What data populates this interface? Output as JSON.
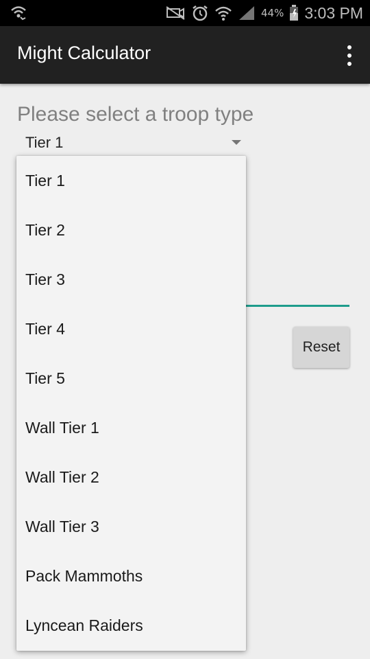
{
  "status_bar": {
    "battery_percent": "44%",
    "time": "3:03 PM",
    "icons": [
      "wifi-call-icon",
      "mute-icon",
      "alarm-icon",
      "wifi-icon",
      "signal-icon",
      "battery-icon"
    ]
  },
  "app_bar": {
    "title": "Might Calculator",
    "menu_icon": "overflow-menu-icon"
  },
  "form": {
    "prompt": "Please select a troop type",
    "selected_troop": "Tier 1",
    "reset_label": "Reset"
  },
  "dropdown": {
    "items": [
      {
        "label": "Tier 1"
      },
      {
        "label": "Tier 2"
      },
      {
        "label": "Tier 3"
      },
      {
        "label": "Tier 4"
      },
      {
        "label": "Tier 5"
      },
      {
        "label": "Wall Tier 1"
      },
      {
        "label": "Wall Tier 2"
      },
      {
        "label": "Wall Tier 3"
      },
      {
        "label": "Pack Mammoths"
      },
      {
        "label": "Lyncean Raiders"
      }
    ]
  },
  "colors": {
    "app_bar": "#212121",
    "accent": "#1e9c8c",
    "background": "#eeeeee"
  }
}
